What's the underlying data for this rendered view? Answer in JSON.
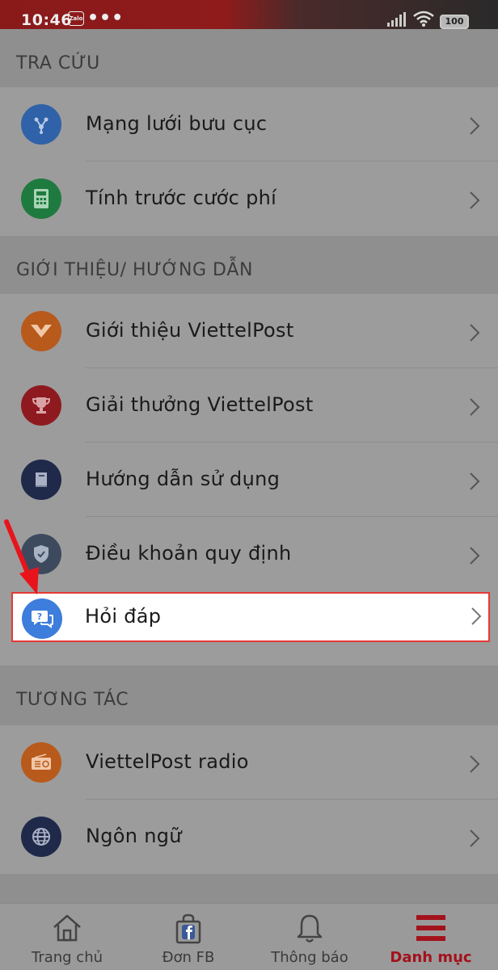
{
  "status_bar": {
    "time": "10:46",
    "zalo_badge": "Zalo",
    "more": "•••",
    "battery": "100"
  },
  "sections": [
    {
      "title": "TRA CỨU",
      "items": [
        {
          "label": "Mạng lưới bưu cục",
          "icon": "network-icon",
          "color": "#2f62a8"
        },
        {
          "label": "Tính trước cước phí",
          "icon": "calculator-icon",
          "color": "#1f7a3f"
        }
      ]
    },
    {
      "title": "GIỚI THIỆU/ HƯỚNG DẪN",
      "items": [
        {
          "label": "Giới thiệu ViettelPost",
          "icon": "viettelpost-logo-icon",
          "color": "#b85a1c"
        },
        {
          "label": "Giải thưởng ViettelPost",
          "icon": "trophy-icon",
          "color": "#8e1a20"
        },
        {
          "label": "Hướng dẫn sử dụng",
          "icon": "book-icon",
          "color": "#1f2a4a"
        },
        {
          "label": "Điều khoản quy định",
          "icon": "shield-check-icon",
          "color": "#3d4a5e"
        },
        {
          "label": "Hỏi đáp",
          "icon": "faq-chat-icon",
          "color": "#3d7ddb"
        }
      ]
    },
    {
      "title": "TƯƠNG TÁC",
      "items": [
        {
          "label": "ViettelPost radio",
          "icon": "radio-icon",
          "color": "#b85a1c"
        },
        {
          "label": "Ngôn ngữ",
          "icon": "globe-icon",
          "color": "#1f2a4a"
        }
      ]
    }
  ],
  "tabs": [
    {
      "label": "Trang chủ",
      "icon": "home-icon",
      "active": false
    },
    {
      "label": "Đơn FB",
      "icon": "facebook-bag-icon",
      "active": false
    },
    {
      "label": "Thông báo",
      "icon": "bell-icon",
      "active": false
    },
    {
      "label": "Danh mục",
      "icon": "menu-icon",
      "active": true
    }
  ]
}
